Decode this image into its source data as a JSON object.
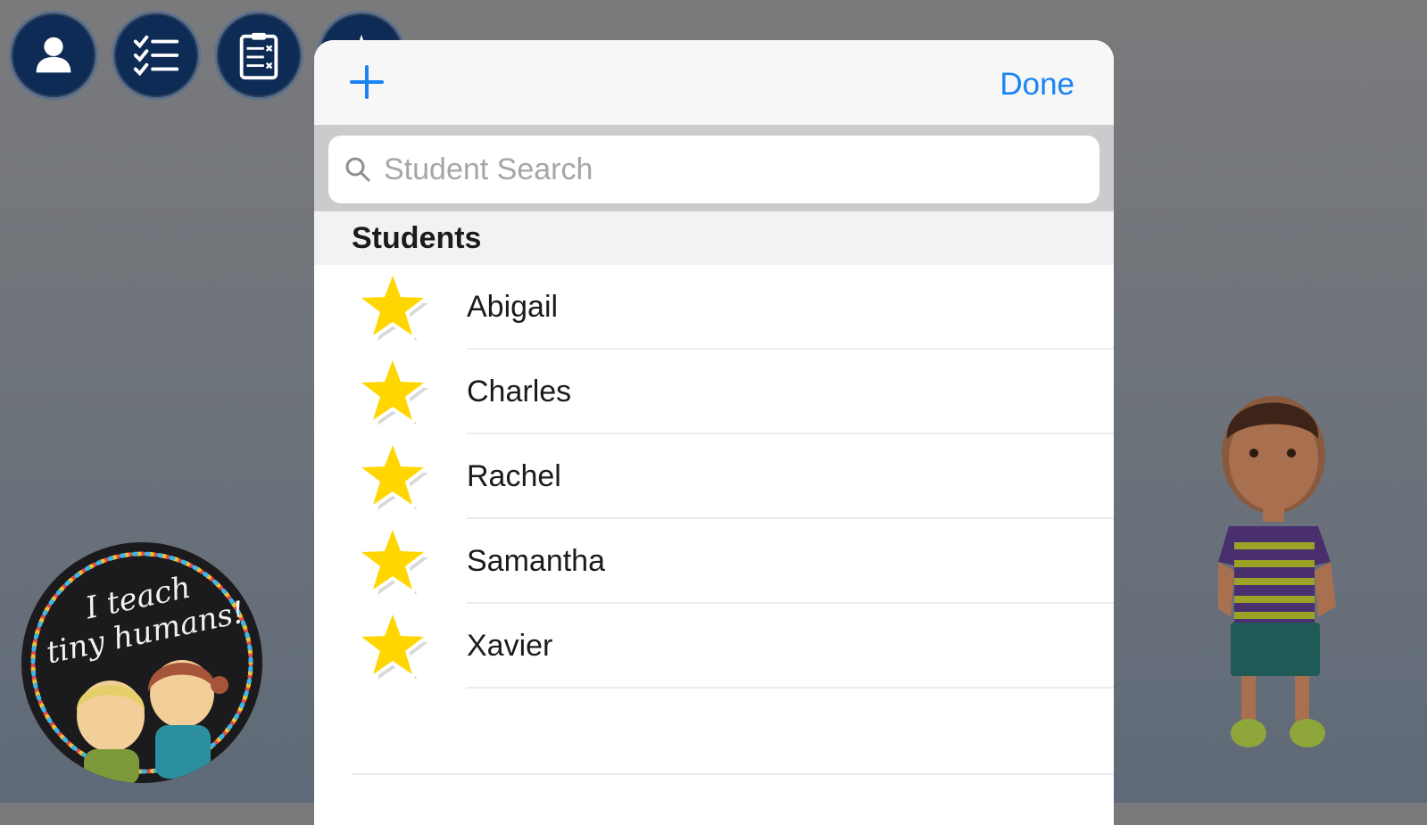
{
  "toolbar": {
    "buttons": [
      {
        "icon": "user-icon"
      },
      {
        "icon": "checklist-icon"
      },
      {
        "icon": "clipboard-icon"
      },
      {
        "icon": "star-icon"
      }
    ]
  },
  "sticker": {
    "text_line1": "I teach",
    "text_line2": "tiny humans!"
  },
  "modal": {
    "add_icon": "plus-icon",
    "done_label": "Done",
    "search_placeholder": "Student Search",
    "section_title": "Students",
    "students": [
      "Abigail",
      "Charles",
      "Rachel",
      "Samantha",
      "Xavier"
    ]
  },
  "colors": {
    "accent": "#1a84f5",
    "toolbar_bg": "#0d2b55",
    "star": "#ffd600"
  }
}
